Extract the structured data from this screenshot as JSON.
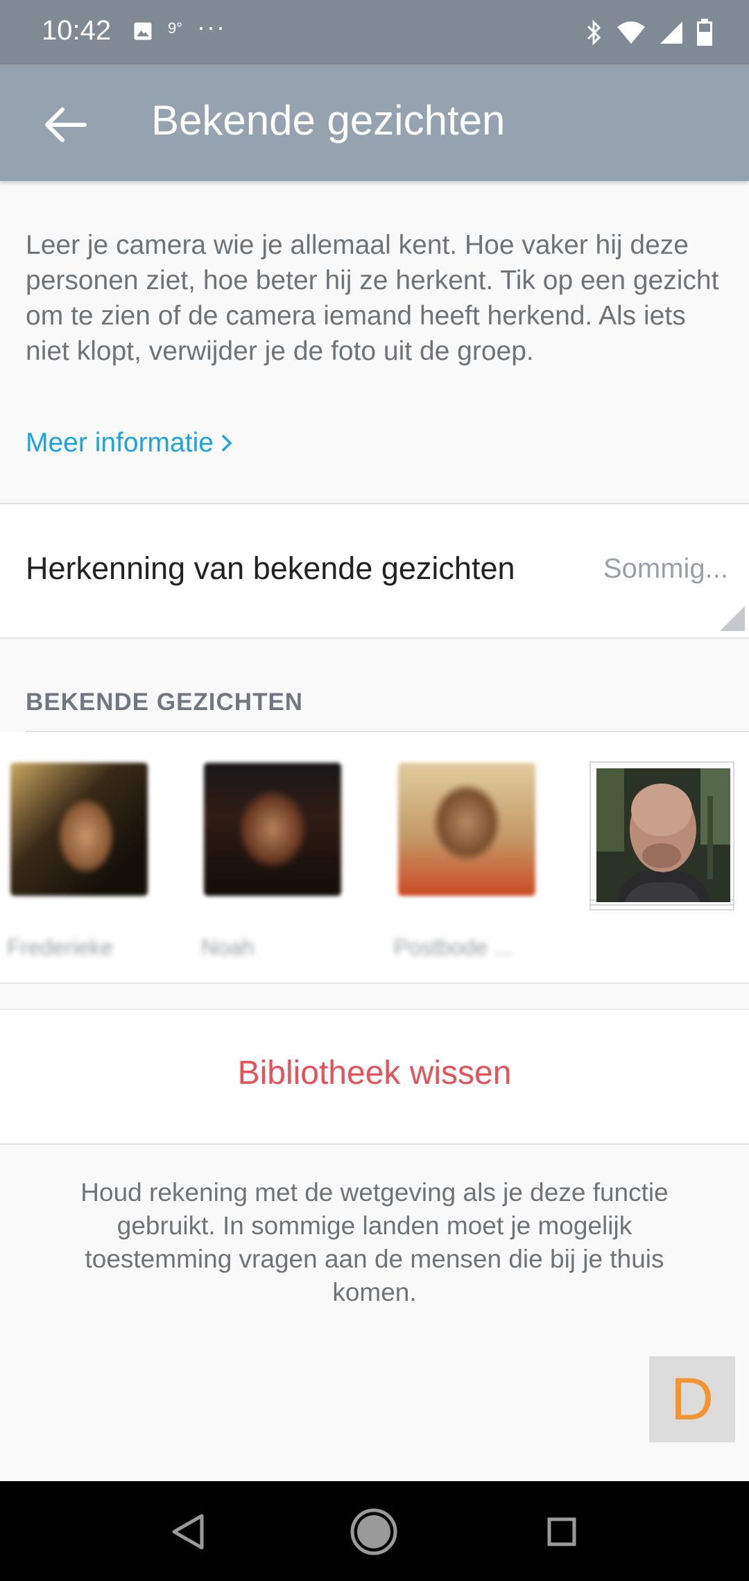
{
  "status_bar": {
    "time": "10:42",
    "temp": "9°",
    "dots": "···"
  },
  "app_bar": {
    "title": "Bekende gezichten"
  },
  "intro": {
    "text": "Leer je camera wie je allemaal kent. Hoe vaker hij deze personen ziet, hoe beter hij ze herkent. Tik op een gezicht om te zien of de camera iemand heeft herkend. Als iets niet klopt, verwijder je de foto uit de groep.",
    "more_link": "Meer informatie"
  },
  "setting": {
    "label": "Herkenning van bekende gezichten",
    "value": "Sommig..."
  },
  "faces_section": {
    "heading": "BEKENDE  GEZICHTEN",
    "faces": [
      {
        "name": "Frederieke"
      },
      {
        "name": "Noah"
      },
      {
        "name": "Postbode ..."
      }
    ]
  },
  "actions": {
    "clear_library": "Bibliotheek wissen"
  },
  "legal": {
    "text": "Houd rekening met de wetgeving als je deze functie gebruikt. In sommige landen moet je mogelijk toestemming vragen aan de mensen die bij je thuis komen."
  },
  "floating": {
    "letter": "D"
  },
  "colors": {
    "app_bar": "#95a3b0",
    "status_bar": "#808a95",
    "link": "#1aa3e8",
    "danger": "#e95158",
    "fab_letter": "#f39431"
  }
}
